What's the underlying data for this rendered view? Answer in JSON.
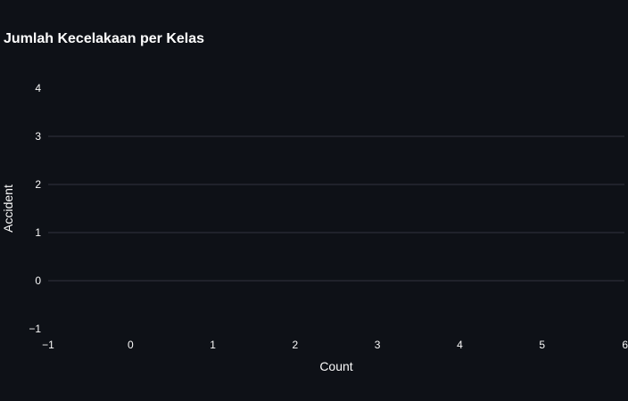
{
  "chart_data": {
    "type": "bar",
    "title": "Jumlah Kecelakaan per Kelas",
    "xlabel": "Count",
    "ylabel": "Accident",
    "categories": [],
    "values": [],
    "xlim": [
      -1,
      6
    ],
    "ylim": [
      -1,
      4
    ],
    "xticks": [
      "−1",
      "0",
      "1",
      "2",
      "3",
      "4",
      "5",
      "6"
    ],
    "yticks": [
      "−1",
      "0",
      "1",
      "2",
      "3",
      "4"
    ],
    "grid": true,
    "legend": "none"
  },
  "colors": {
    "background": "#0e1117",
    "text": "#ffffff",
    "axis_text": "#fafafa",
    "grid": "#31333f"
  }
}
